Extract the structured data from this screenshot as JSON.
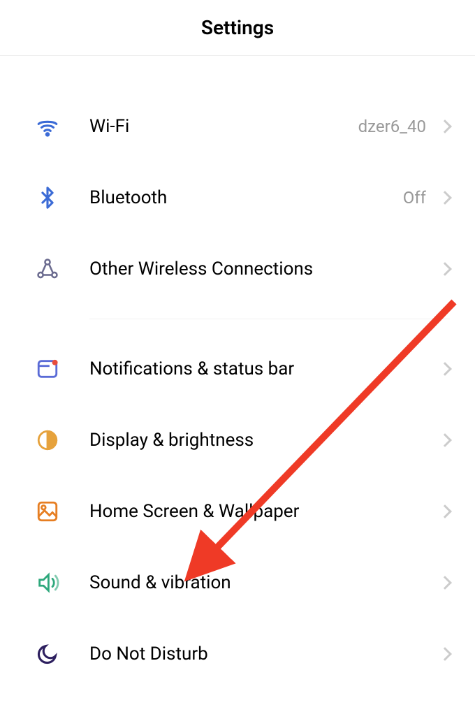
{
  "header": {
    "title": "Settings"
  },
  "groups": [
    {
      "items": [
        {
          "icon": "wifi-icon",
          "label": "Wi-Fi",
          "value": "dzer6_40"
        },
        {
          "icon": "bluetooth-icon",
          "label": "Bluetooth",
          "value": "Off"
        },
        {
          "icon": "wireless-icon",
          "label": "Other Wireless Connections",
          "value": ""
        }
      ]
    },
    {
      "items": [
        {
          "icon": "notifications-icon",
          "label": "Notifications & status bar",
          "value": ""
        },
        {
          "icon": "display-icon",
          "label": "Display & brightness",
          "value": ""
        },
        {
          "icon": "home-icon",
          "label": "Home Screen & Wallpaper",
          "value": ""
        },
        {
          "icon": "sound-icon",
          "label": "Sound & vibration",
          "value": ""
        },
        {
          "icon": "dnd-icon",
          "label": "Do Not Disturb",
          "value": ""
        }
      ]
    }
  ],
  "icon_colors": {
    "wifi": "#3b6bd6",
    "bluetooth": "#3b6bd6",
    "wireless": "#6b6b8f",
    "notifications": "#5a6bd6",
    "display": "#e6a23c",
    "home": "#e67e22",
    "sound": "#2ea87c",
    "dnd": "#2d1f5f"
  },
  "annotation": {
    "arrow_color": "#ef3a26"
  }
}
